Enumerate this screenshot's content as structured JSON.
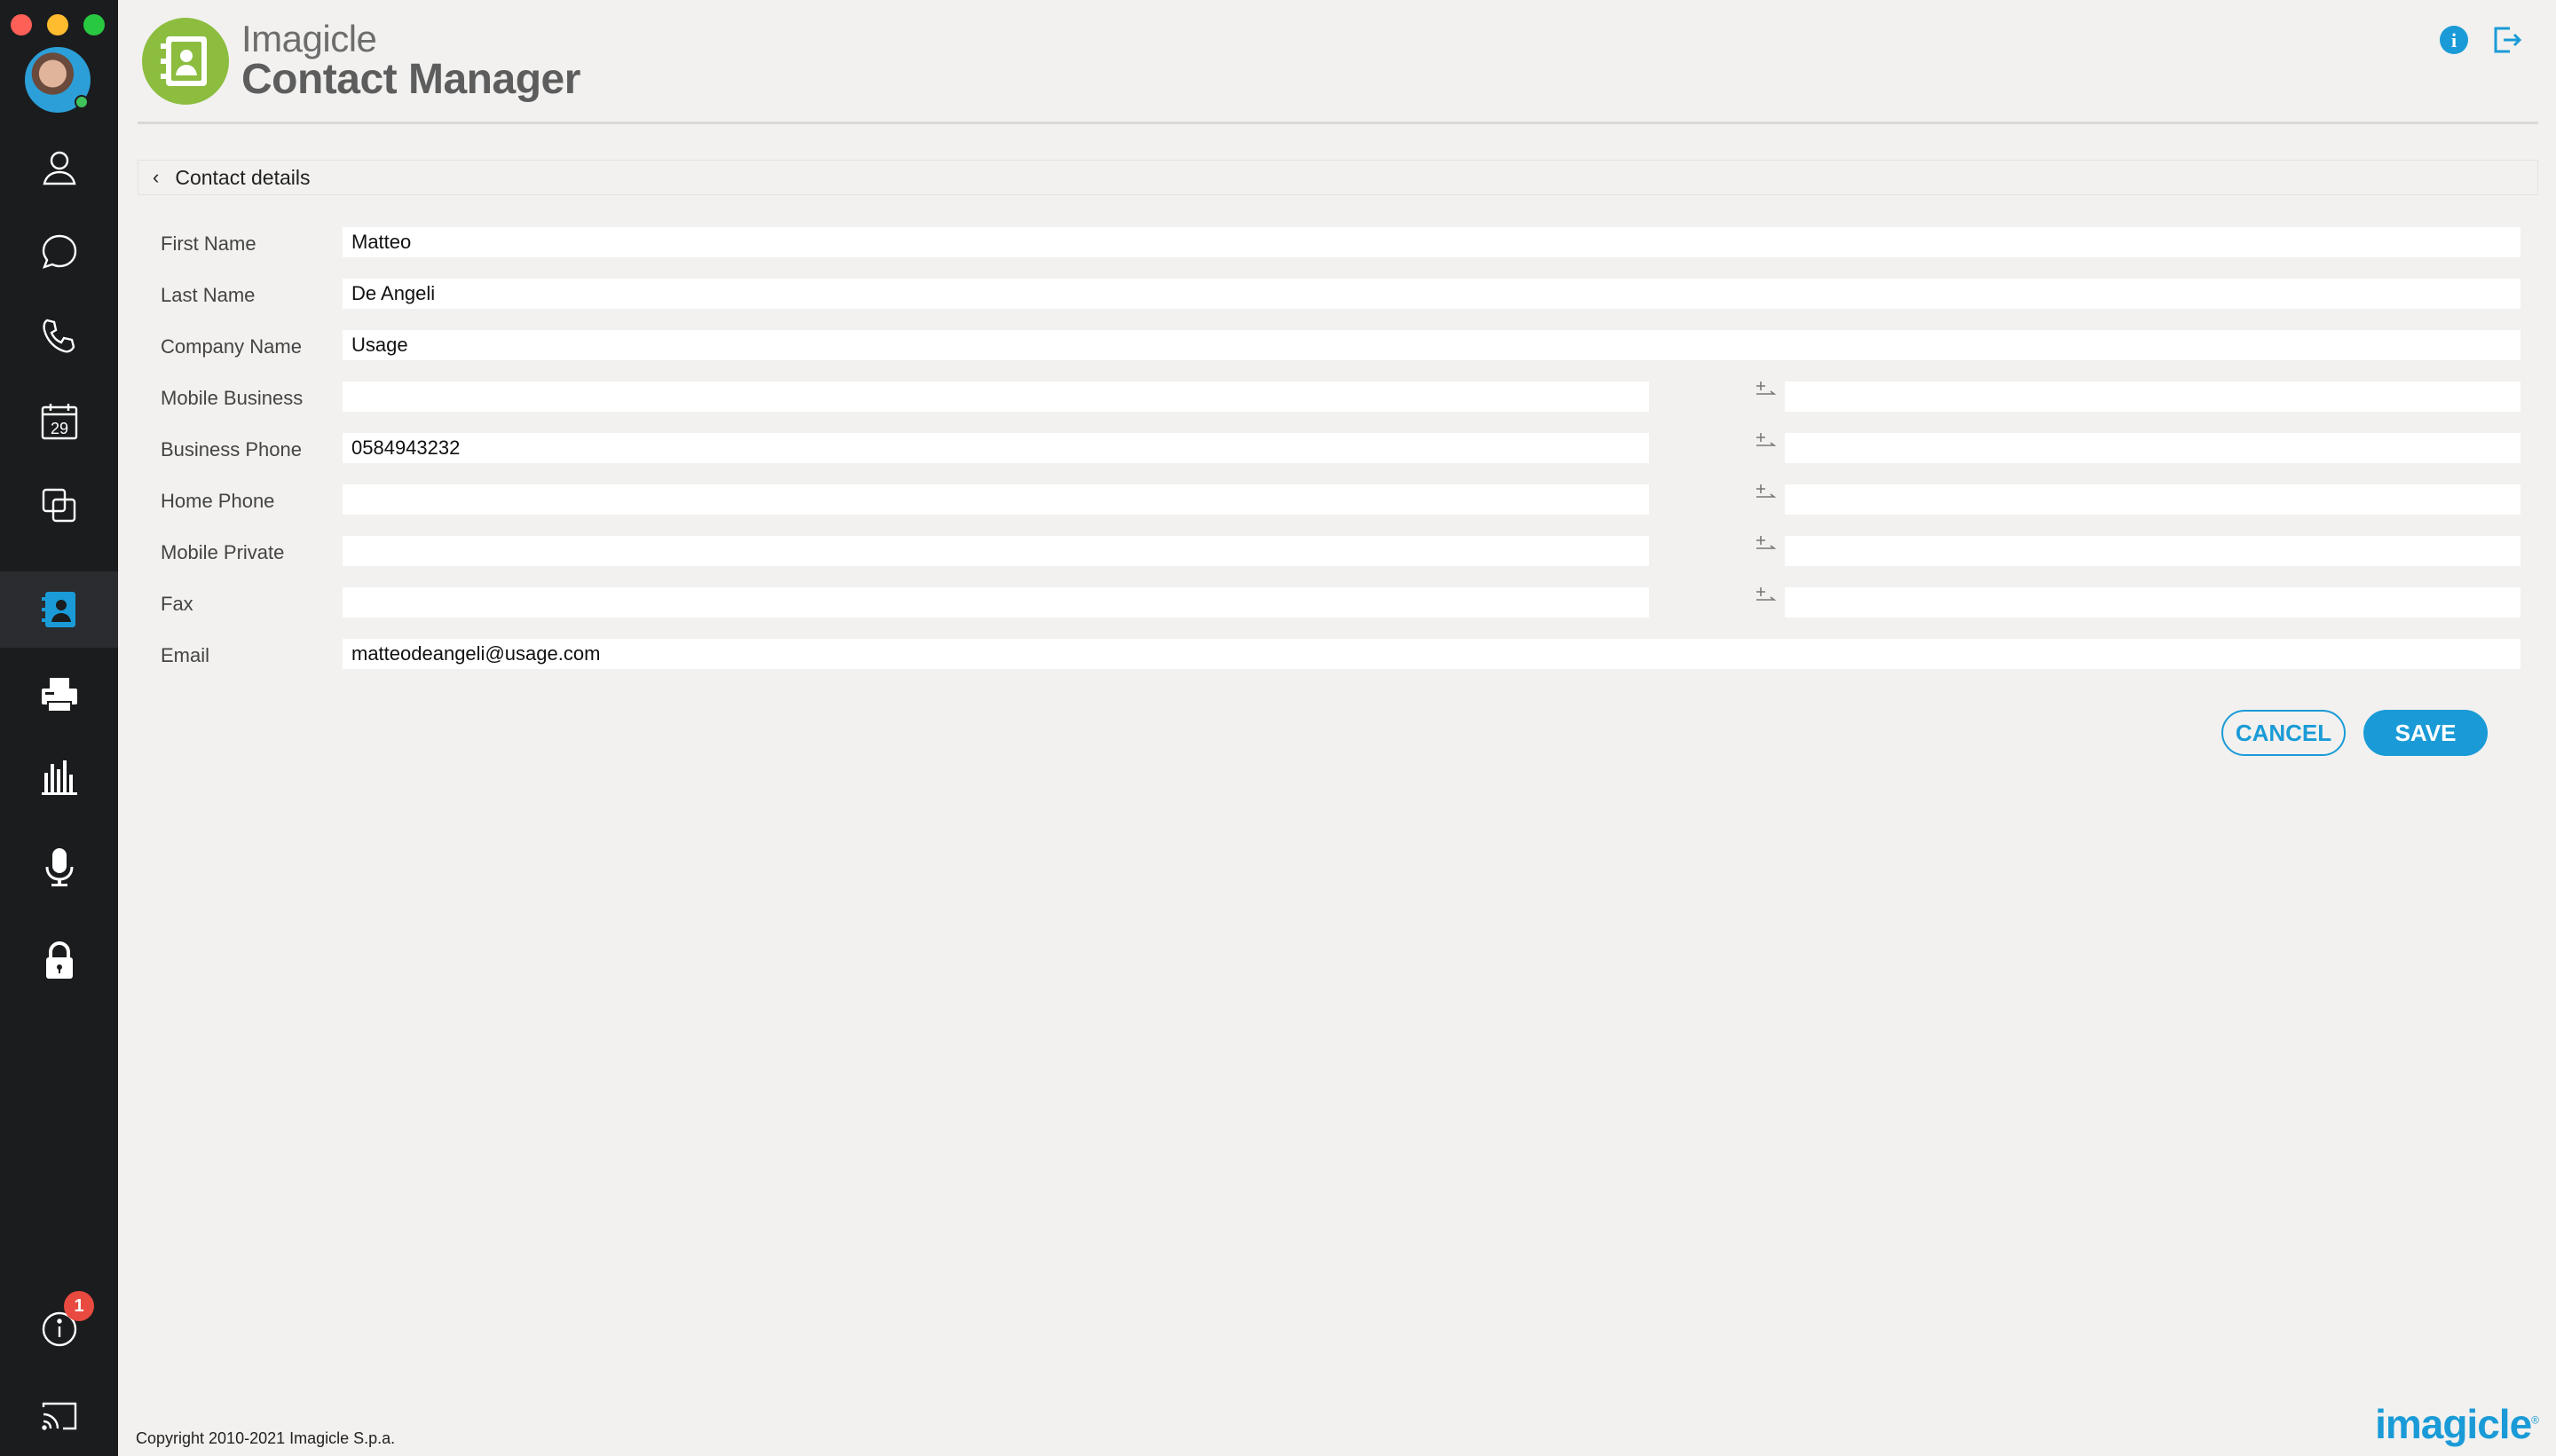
{
  "colors": {
    "accent": "#1a9bd7",
    "sidebar_bg": "#1b1c1e",
    "app_bg": "#f2f1ef",
    "brand_green": "#8cbd3f",
    "badge_red": "#e84a3f"
  },
  "header": {
    "brand": "Imagicle",
    "app_name": "Contact Manager",
    "icons": [
      "info-icon",
      "logout-icon"
    ]
  },
  "sidebar": {
    "items": [
      {
        "name": "contacts",
        "icon": "person-icon"
      },
      {
        "name": "chat",
        "icon": "chat-bubble-icon"
      },
      {
        "name": "calls",
        "icon": "phone-icon"
      },
      {
        "name": "calendar",
        "icon": "calendar-icon",
        "label": "29"
      },
      {
        "name": "screen-share",
        "icon": "overlap-squares-icon"
      },
      {
        "name": "contact-manager",
        "icon": "address-book-icon",
        "active": true
      },
      {
        "name": "fax",
        "icon": "fax-icon"
      },
      {
        "name": "analytics",
        "icon": "bar-chart-icon"
      },
      {
        "name": "recording",
        "icon": "microphone-icon"
      },
      {
        "name": "security",
        "icon": "lock-icon"
      }
    ],
    "bottom": {
      "info_badge": "1",
      "cast_icon": "cast-icon"
    }
  },
  "breadcrumb": {
    "label": "Contact details"
  },
  "form": {
    "first_name": {
      "label": "First Name",
      "value": "Matteo"
    },
    "last_name": {
      "label": "Last Name",
      "value": "De Angeli"
    },
    "company_name": {
      "label": "Company Name",
      "value": "Usage"
    },
    "mobile_business": {
      "label": "Mobile Business",
      "value": "",
      "ext": ""
    },
    "business_phone": {
      "label": "Business Phone",
      "value": "0584943232",
      "ext": ""
    },
    "home_phone": {
      "label": "Home Phone",
      "value": "",
      "ext": ""
    },
    "mobile_private": {
      "label": "Mobile Private",
      "value": "",
      "ext": ""
    },
    "fax": {
      "label": "Fax",
      "value": "",
      "ext": ""
    },
    "email": {
      "label": "Email",
      "value": "matteodeangeli@usage.com"
    }
  },
  "actions": {
    "cancel": "CANCEL",
    "save": "SAVE"
  },
  "footer": {
    "copyright": "Copyright 2010-2021 Imagicle S.p.a.",
    "logo": "imagicle"
  }
}
